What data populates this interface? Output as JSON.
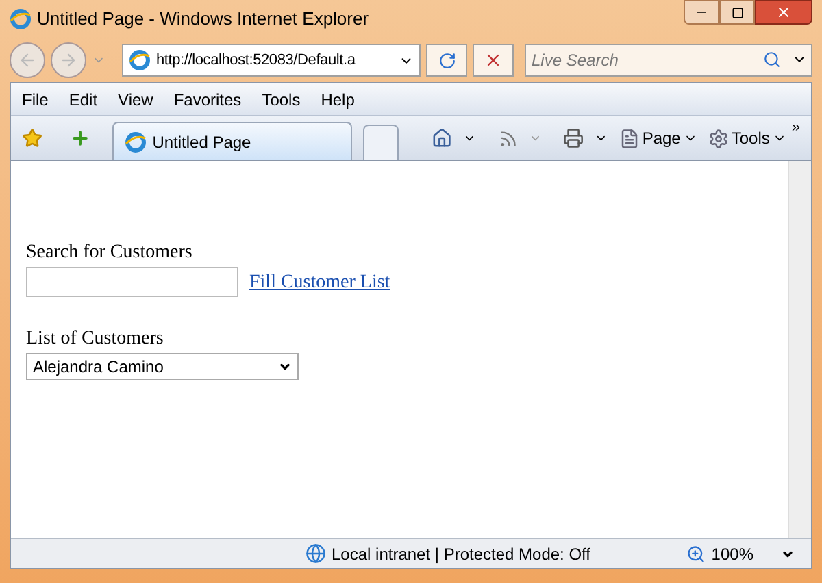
{
  "window": {
    "title": "Untitled Page - Windows Internet Explorer"
  },
  "address_bar": {
    "value": "http://localhost:52083/Default.a"
  },
  "search": {
    "placeholder": "Live Search"
  },
  "menu": [
    "File",
    "Edit",
    "View",
    "Favorites",
    "Tools",
    "Help"
  ],
  "tab": {
    "label": "Untitled Page",
    "selected": true
  },
  "command_bar": {
    "page": "Page",
    "tools": "Tools",
    "chevron": "»"
  },
  "page": {
    "search_label": "Search for Customers",
    "fill_link": "Fill Customer List",
    "list_label": "List of Customers",
    "list_value": "Alejandra Camino"
  },
  "status_bar": {
    "zone": "Local intranet | Protected Mode: Off",
    "zoom": "100%"
  }
}
